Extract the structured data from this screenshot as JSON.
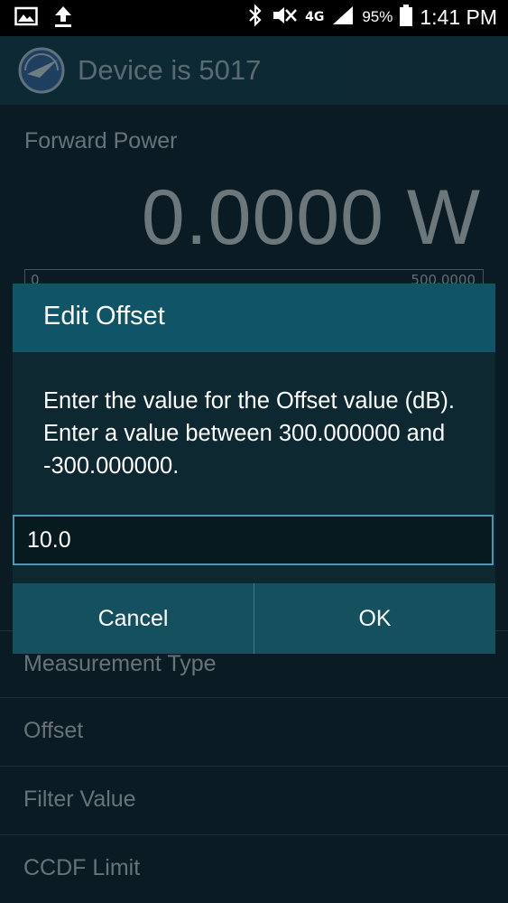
{
  "status_bar": {
    "battery_percent": "95%",
    "time": "1:41 PM",
    "network": "4G",
    "icons": [
      "image-icon",
      "upload-icon",
      "bluetooth-icon",
      "mute-icon",
      "network-4g-icon",
      "signal-icon",
      "battery-icon"
    ]
  },
  "app_bar": {
    "title": "Device is 5017",
    "logo": "app-logo-icon"
  },
  "background": {
    "forward_power_label": "Forward Power",
    "forward_power_value": "0.0000 W",
    "range_min": "0",
    "range_max": "500.0000",
    "list_items": [
      {
        "label": "Measurement Type"
      },
      {
        "label": "Offset"
      },
      {
        "label": "Filter Value"
      },
      {
        "label": "CCDF Limit"
      }
    ]
  },
  "dialog": {
    "title": "Edit Offset",
    "message": "Enter the value for the Offset value (dB). Enter a value between 300.000000 and -300.000000.",
    "input_value": "10.0",
    "cancel_label": "Cancel",
    "ok_label": "OK"
  },
  "colors": {
    "app_bar": "#123c49",
    "dialog_header": "#0f5467",
    "dialog_buttons": "#15505f",
    "input_border": "#4a98b1"
  }
}
